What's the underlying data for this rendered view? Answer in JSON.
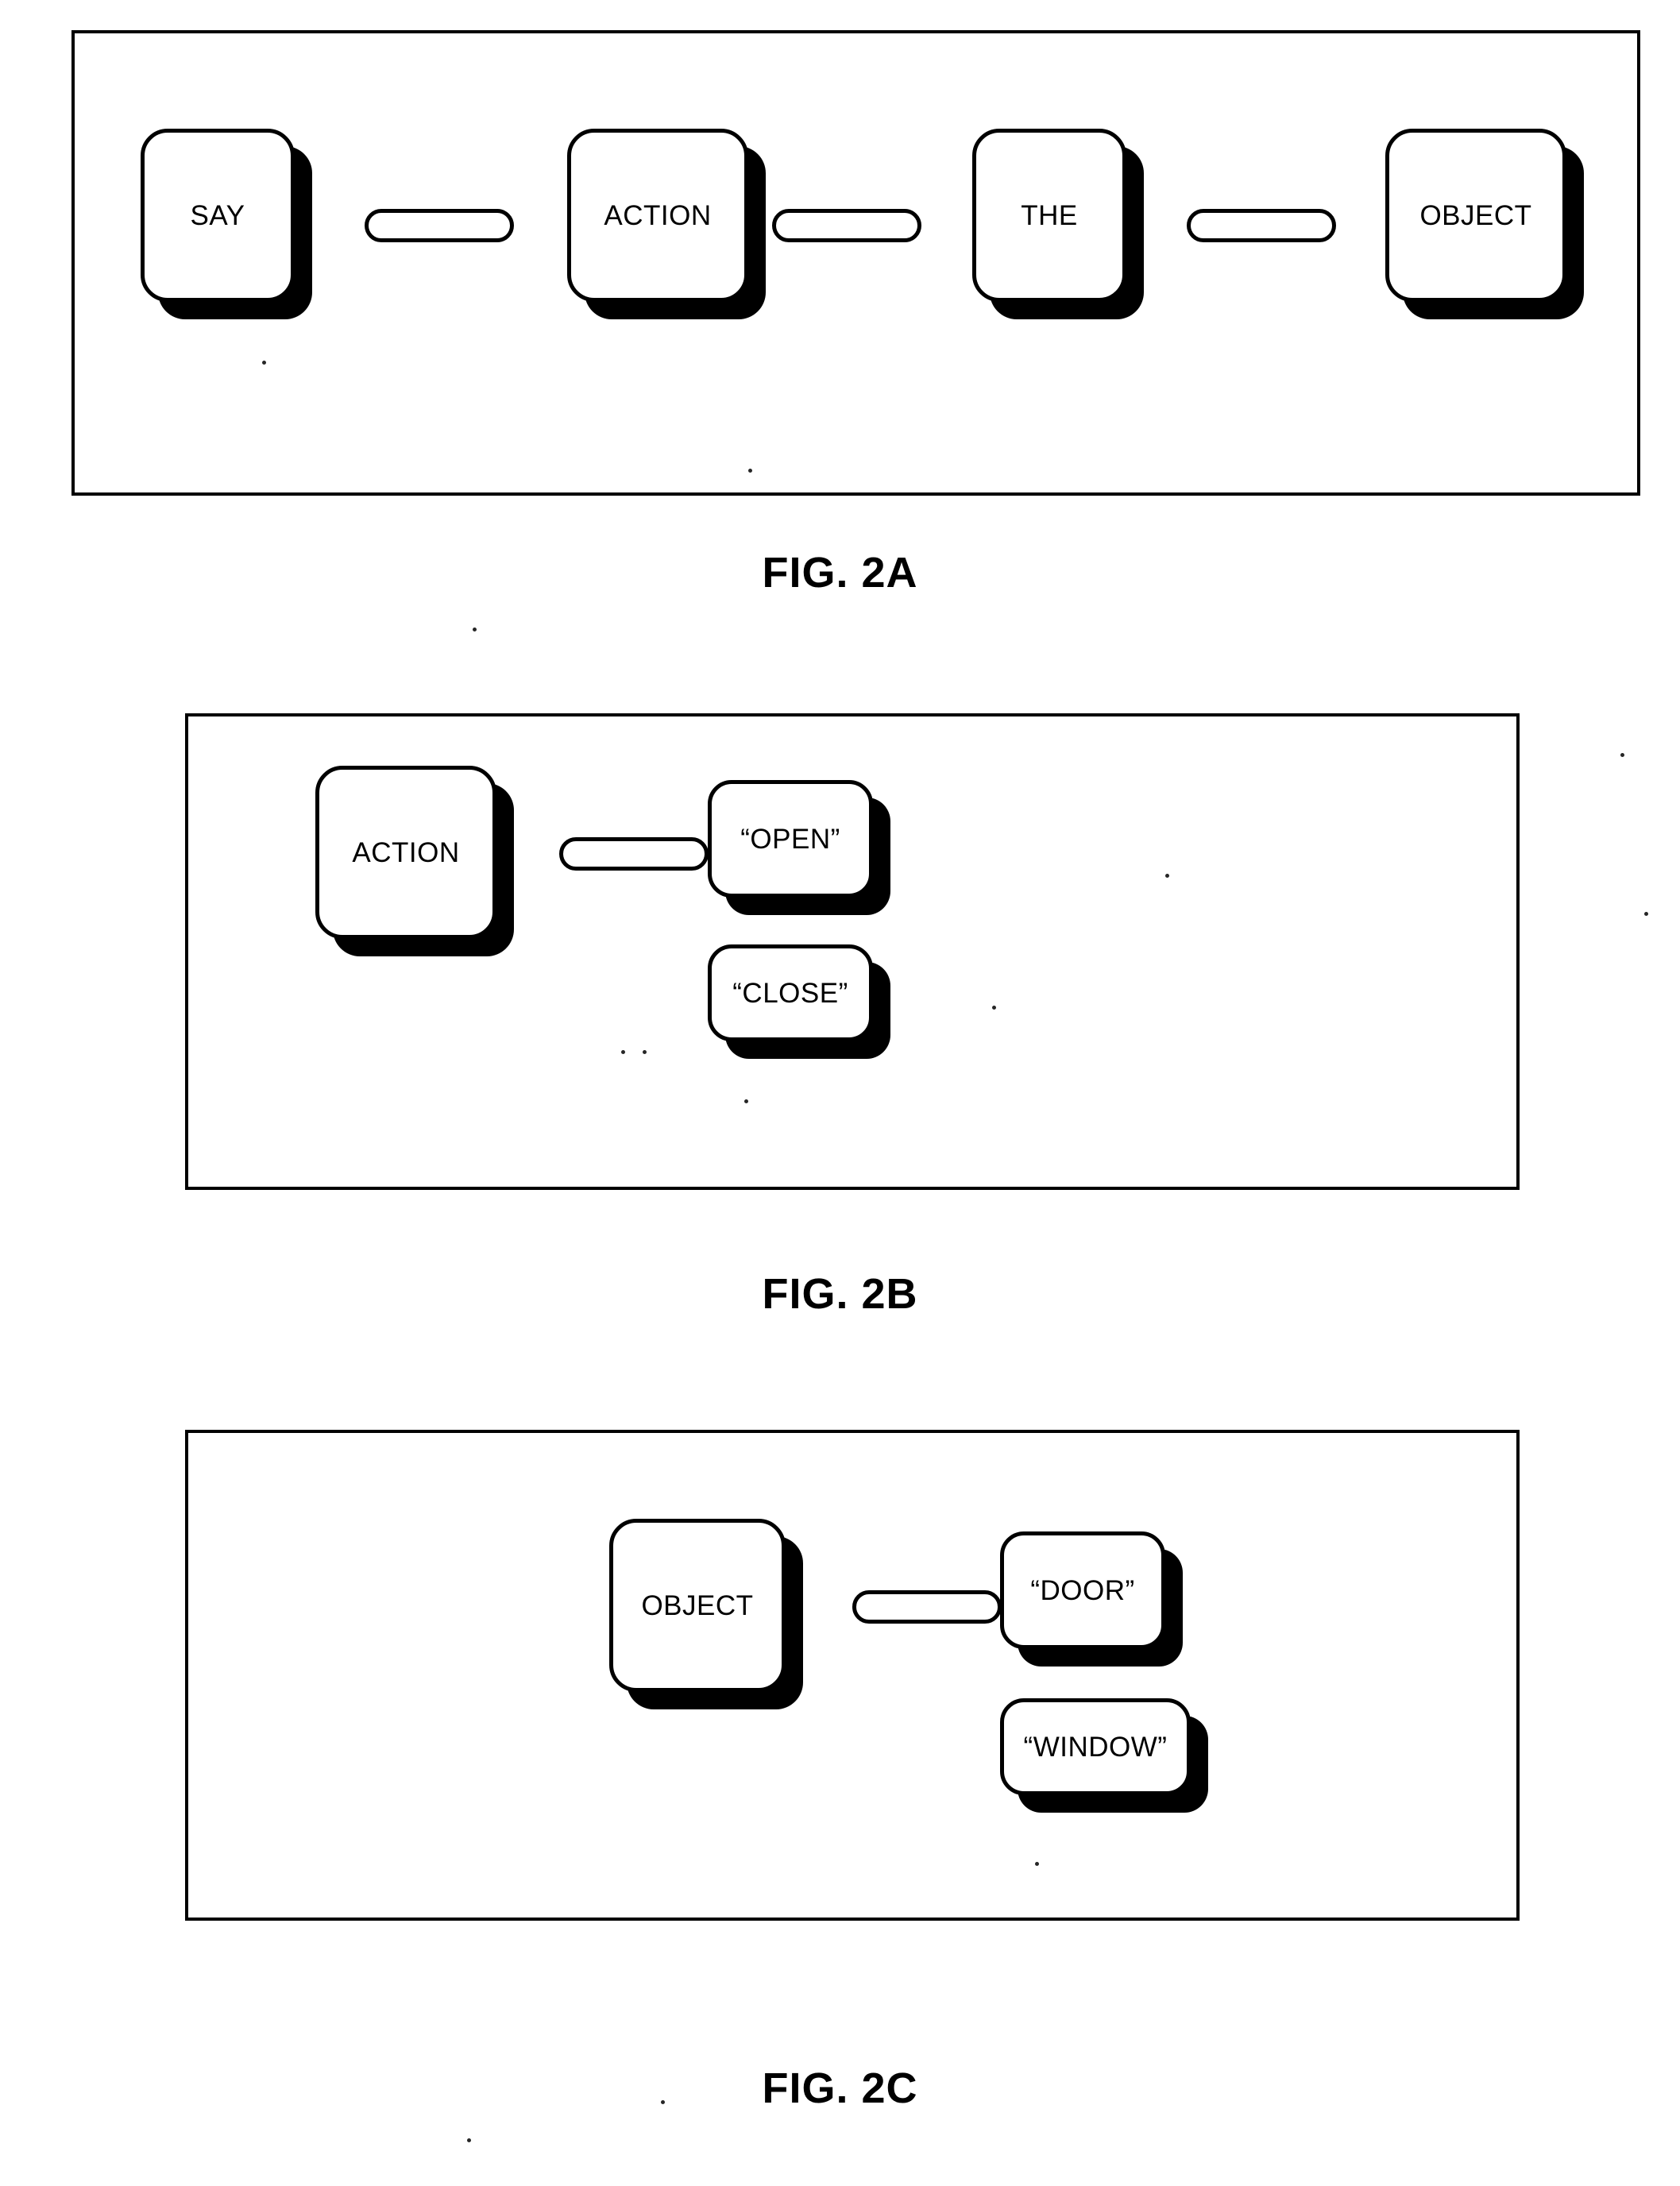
{
  "page": {
    "background": "#ffffff",
    "ink": "#000000"
  },
  "figures": [
    {
      "id": "fig-2a",
      "caption": "FIG. 2A",
      "nodes": [
        {
          "key": "say",
          "label": "SAY"
        },
        {
          "key": "action",
          "label": "ACTION"
        },
        {
          "key": "the",
          "label": "THE"
        },
        {
          "key": "object",
          "label": "OBJECT"
        }
      ],
      "connectors": [
        {
          "key": "say-action"
        },
        {
          "key": "action-the"
        },
        {
          "key": "the-object"
        }
      ]
    },
    {
      "id": "fig-2b",
      "caption": "FIG. 2B",
      "nodes": [
        {
          "key": "action",
          "label": "ACTION"
        },
        {
          "key": "open",
          "label": "“OPEN”"
        },
        {
          "key": "close",
          "label": "“CLOSE”"
        }
      ],
      "connectors": [
        {
          "key": "action-open"
        }
      ]
    },
    {
      "id": "fig-2c",
      "caption": "FIG. 2C",
      "nodes": [
        {
          "key": "object",
          "label": "OBJECT"
        },
        {
          "key": "door",
          "label": "“DOOR”"
        },
        {
          "key": "window",
          "label": "“WINDOW”"
        }
      ],
      "connectors": [
        {
          "key": "object-door"
        }
      ]
    }
  ]
}
